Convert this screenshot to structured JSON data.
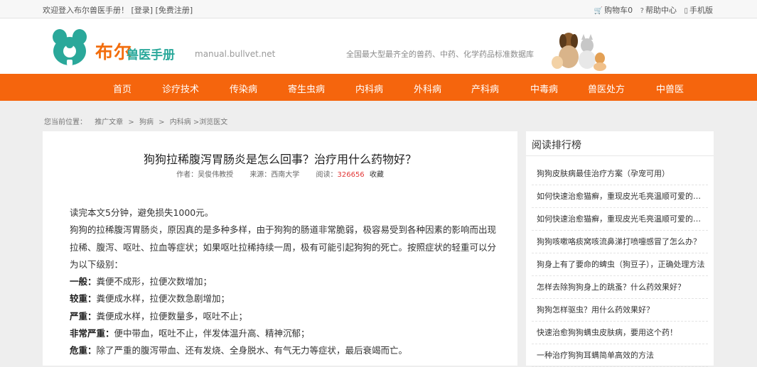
{
  "topbar": {
    "welcome": "欢迎登入布尔兽医手册！",
    "login": "[登录]",
    "register": "[免费注册]",
    "cart": "购物车0",
    "help": "帮助中心",
    "mobile": "手机版"
  },
  "header": {
    "logo_name": "布尔",
    "logo_sub": "兽医手册",
    "logo_url": "manual.bullvet.net",
    "slogan": "全国最大型最齐全的兽药、中药、化学药品标准数据库"
  },
  "nav": [
    "首页",
    "诊疗技术",
    "传染病",
    "寄生虫病",
    "内科病",
    "外科病",
    "产科病",
    "中毒病",
    "兽医处方",
    "中兽医"
  ],
  "breadcrumb": {
    "label": "您当前位置：",
    "items": [
      "推广文章",
      "狗病",
      "内科病"
    ],
    "current": ">浏览医文"
  },
  "article": {
    "title": "狗狗拉稀腹泻胃肠炎是怎么回事？治疗用什么药物好？",
    "author": "作者：吴俊伟教授",
    "source": "来源：西南大学",
    "views_label": "阅读：",
    "views": "326656",
    "favorite": "收藏",
    "intro": "读完本文5分钟，避免损失1000元。",
    "para": "狗狗的拉稀腹泻胃肠炎，原因真的是多种多样，由于狗狗的肠道非常脆弱，极容易受到各种因素的影响而出现拉稀、腹泻、呕吐、拉血等症状；如果呕吐拉稀持续一周，极有可能引起狗狗的死亡。按照症状的轻重可以分为以下级别：",
    "levels": [
      {
        "name": "一般：",
        "desc": "粪便不成形，拉便次数增加；"
      },
      {
        "name": "较重：",
        "desc": "粪便成水样，拉便次数急剧增加；"
      },
      {
        "name": "严重：",
        "desc": "粪便成水样，拉便数量多，呕吐不止；"
      },
      {
        "name": "非常严重：",
        "desc": "便中带血，呕吐不止，伴发体温升高、精神沉郁；"
      },
      {
        "name": "危重：",
        "desc": "除了严重的腹泻带血、还有发烧、全身脱水、有气无力等症状，最后衰竭而亡。"
      }
    ]
  },
  "sidebar": {
    "title": "阅读排行榜",
    "items": [
      "狗狗皮肤病最佳治疗方案（孕宠可用）",
      "如何快速治愈猫癣，重现皮光毛亮温顺可爱的猫咪",
      "如何快速治愈猫癣，重现皮光毛亮温顺可爱的猫咪",
      "狗狗咳嗽咯痰窝咳流鼻涕打喷嚏感冒了怎么办？",
      "狗身上有了要命的蜱虫（狗豆子），正确处理方法",
      "怎样去除狗狗身上的跳蚤？什么药效果好？",
      "狗狗怎样驱虫？用什么药效果好？",
      "快速治愈狗狗螨虫皮肤病，要用这个药！",
      "一种治疗狗狗耳螨简单高效的方法"
    ]
  },
  "colors": {
    "brand_orange": "#f5650d",
    "logo_teal": "#2aa89a",
    "views_red": "#e23636"
  }
}
